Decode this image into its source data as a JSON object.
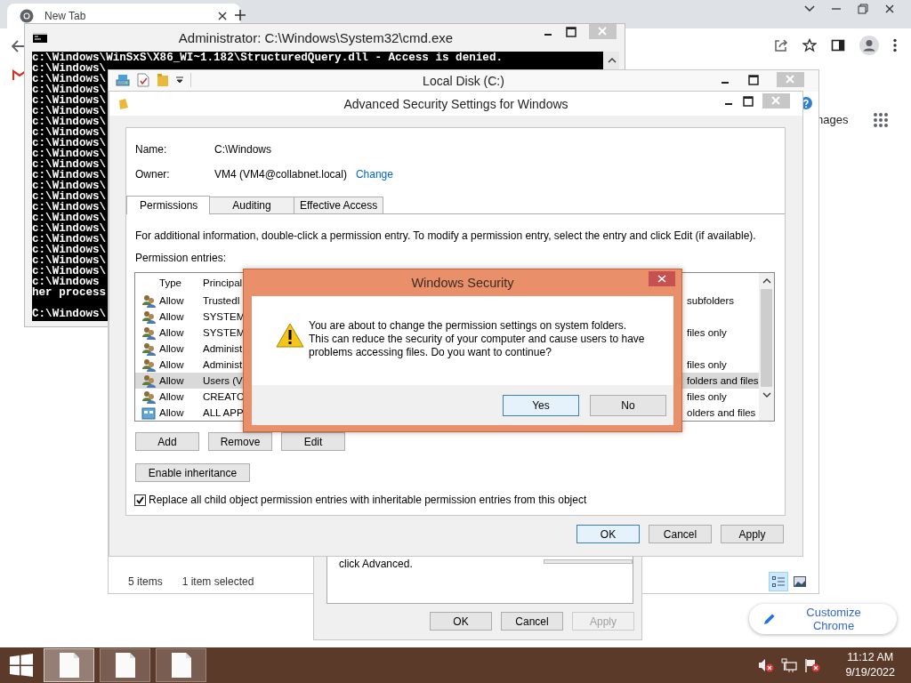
{
  "browser": {
    "tab_title": "New Tab",
    "images_link": "nages",
    "customize_button": "Customize Chrome"
  },
  "cmd": {
    "title": "Administrator: C:\\Windows\\System32\\cmd.exe",
    "lines": [
      "c:\\Windows\\WinSxS\\X86_WI~1.182\\StructuredQuery.dll - Access is denied.",
      "c:\\Windows\\",
      "c:\\Windows\\",
      "c:\\Windows\\",
      "c:\\Windows\\",
      "c:\\Windows\\",
      "c:\\Windows\\",
      "c:\\Windows\\",
      "c:\\Windows\\",
      "c:\\Windows\\",
      "c:\\Windows\\",
      "c:\\Windows\\",
      "c:\\Windows\\",
      "c:\\Windows\\",
      "c:\\Windows\\",
      "c:\\Windows\\",
      "c:\\Windows\\",
      "c:\\Windows\\",
      "c:\\Windows\\",
      "c:\\Windows\\",
      "c:\\Windows\\",
      "c:\\Windows",
      "her process"
    ],
    "prompt": "C:\\Windows\\"
  },
  "explorer": {
    "title": "Local Disk (C:)",
    "item_count": "5 items",
    "selection": "1 item selected",
    "views": [
      {
        "selected": true
      },
      {
        "selected": false
      }
    ]
  },
  "properties": {
    "text": "click Advanced.",
    "buttons": [
      {
        "label": "OK",
        "disabled": false
      },
      {
        "label": "Cancel",
        "disabled": false
      },
      {
        "label": "Apply",
        "disabled": true
      }
    ]
  },
  "advanced": {
    "title": "Advanced Security Settings for Windows",
    "name_label": "Name:",
    "name_value": "C:\\Windows",
    "owner_label": "Owner:",
    "owner_value": "VM4 (VM4@collabnet.local)",
    "owner_link": "Change",
    "tabs": [
      {
        "label": "Permissions",
        "selected": true
      },
      {
        "label": "Auditing",
        "selected": false
      },
      {
        "label": "Effective Access",
        "selected": false
      }
    ],
    "info": "For additional information, double-click a permission entry. To modify a permission entry, select the entry and click Edit (if available).",
    "entries_label": "Permission entries:",
    "columns": [
      "Type",
      "Principal"
    ],
    "rows": [
      {
        "kind": "group",
        "type": "Allow",
        "principal": "TrustedI",
        "last_column": "subfolders",
        "selected": false
      },
      {
        "kind": "group",
        "type": "Allow",
        "principal": "SYSTEM",
        "selected": false
      },
      {
        "kind": "group",
        "type": "Allow",
        "principal": "SYSTEM",
        "last_column": "files only",
        "selected": false
      },
      {
        "kind": "group",
        "type": "Allow",
        "principal": "Administ",
        "selected": false
      },
      {
        "kind": "group",
        "type": "Allow",
        "principal": "Administ",
        "last_column": "files only",
        "selected": false
      },
      {
        "kind": "group",
        "type": "Allow",
        "principal": "Users (V",
        "last_column": "folders and files",
        "selected": true
      },
      {
        "kind": "group",
        "type": "Allow",
        "principal": "CREATO",
        "last_column": "files only",
        "selected": false
      },
      {
        "kind": "package",
        "type": "Allow",
        "principal": "ALL APP",
        "last_column": "olders and files",
        "selected": false
      }
    ],
    "list_buttons": [
      "Add",
      "Remove",
      "Edit"
    ],
    "inheritance_button": "Enable inheritance",
    "replace_option": {
      "label": "Replace all child object permission entries with inheritable permission entries from this object",
      "checked": true
    },
    "buttons": [
      {
        "label": "OK",
        "default": true
      },
      {
        "label": "Cancel",
        "default": false
      },
      {
        "label": "Apply",
        "default": false
      }
    ]
  },
  "dialog": {
    "title": "Windows Security",
    "message_lines": [
      "You are about to change the permission settings on system folders.",
      "This can reduce the security of your computer and cause users to have",
      "problems accessing files. Do you want to continue?"
    ],
    "buttons": [
      {
        "label": "Yes",
        "default": true
      },
      {
        "label": "No",
        "default": false
      }
    ]
  },
  "taskbar": {
    "items": [
      {
        "selected": true
      },
      {
        "selected": false
      },
      {
        "selected": false
      }
    ],
    "time": "11:12 AM",
    "date": "9/19/2022"
  }
}
